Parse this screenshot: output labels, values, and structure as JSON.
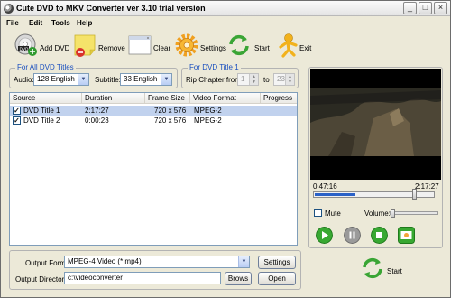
{
  "window": {
    "title": "Cute DVD to MKV Converter ver 3.10  trial version",
    "min": "_",
    "max": "□",
    "close": "×"
  },
  "menu": [
    "File",
    "Edit",
    "Tools",
    "Help"
  ],
  "toolbar": {
    "add_dvd": "Add DVD",
    "remove": "Remove",
    "clear": "Clear",
    "settings": "Settings",
    "start": "Start",
    "exit": "Exit"
  },
  "all_titles": {
    "group_label": "For All DVD Titles",
    "audio_label": "Audio:",
    "audio_value": "128  English",
    "subtitle_label": "Subtitle:",
    "subtitle_value": "33  English"
  },
  "title_one": {
    "group_label": "For DVD Title 1",
    "rip_label": "Rip Chapter from:",
    "from_value": "1",
    "to_label": "to",
    "to_value": "23"
  },
  "table": {
    "headers": [
      "Source",
      "Duration",
      "Frame Size",
      "Video Format",
      "Progress"
    ],
    "rows": [
      {
        "checked": "✓",
        "source": "DVD Title 1",
        "duration": "2:17:27",
        "frame_size": "720 x 576",
        "format": "MPEG-2",
        "progress": ""
      },
      {
        "checked": "✓",
        "source": "DVD Title 2",
        "duration": "0:00:23",
        "frame_size": "720 x 576",
        "format": "MPEG-2",
        "progress": ""
      }
    ]
  },
  "output": {
    "format_label": "Output Format:",
    "format_value": "MPEG-4 Video (*.mp4)",
    "settings_button": "Settings",
    "dir_label": "Output Directory:",
    "dir_value": "c:\\videoconverter",
    "browse_button": "Brows",
    "open_button": "Open"
  },
  "player": {
    "current_time": "0:47:16",
    "total_time": "2:17:27",
    "progress_fraction": 0.34,
    "mute_label": "Mute",
    "volume_label": "Volume:",
    "volume_fraction": 0.0
  },
  "bottom_start": "Start",
  "colors": {
    "selected_row": "#c1d2ee",
    "play_green": "#38a832",
    "accent_blue": "#2a61c7"
  }
}
